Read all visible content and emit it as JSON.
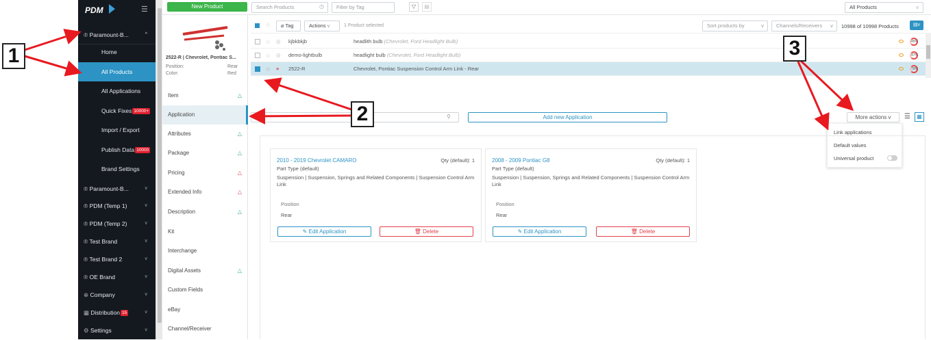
{
  "sidebar": {
    "logo": "PDM",
    "header_brand": "Paramount-B...",
    "items": [
      {
        "label": "Home"
      },
      {
        "label": "All Products"
      },
      {
        "label": "All Applications"
      },
      {
        "label": "Quick Fixes",
        "badge": "10000+"
      },
      {
        "label": "Import / Export"
      },
      {
        "label": "Publish Data",
        "badge": "10000"
      },
      {
        "label": "Brand Settings"
      }
    ],
    "brands": [
      {
        "label": "Paramount-B..."
      },
      {
        "label": "PDM (Temp 1)"
      },
      {
        "label": "PDM (Temp 2)"
      },
      {
        "label": "Test Brand"
      },
      {
        "label": "Test Brand 2"
      },
      {
        "label": "OE Brand"
      },
      {
        "label": "Company"
      },
      {
        "label": "Distribution",
        "badge": "15"
      },
      {
        "label": "Settings"
      }
    ]
  },
  "toolbar": {
    "new_product": "New Product",
    "search_placeholder": "Search Products",
    "filter_placeholder": "Filter by Tag",
    "scope": "All Products"
  },
  "product_preview": {
    "title": "2522-R | Chevrolet, Pontiac S...",
    "position_label": "Position:",
    "position_value": "Rear",
    "color_label": "Color:",
    "color_value": "Red"
  },
  "list_bar": {
    "tag": "Tag",
    "actions": "Actions",
    "selected": "1 Product selected",
    "sort": "Sort products by",
    "channels": "Channels/Receivers",
    "count": "10998 of 10998 Products"
  },
  "rows": [
    {
      "sku": "kjbkbkjb",
      "name": "headlith bulb",
      "fit": "(Chevrolet, Ford Headlight Bulb)",
      "score": "45%"
    },
    {
      "sku": "demo-lightbulb",
      "name": "headlight bulb",
      "fit": "(Chevrolet, Ford Headlight Bulb)",
      "score": "47%"
    },
    {
      "sku": "2522-R",
      "name": "Chevrolet, Pontiac Suspension Control Arm Link - Rear",
      "fit": "",
      "score": "79%"
    }
  ],
  "tabs": [
    {
      "label": "Item",
      "status": "ok"
    },
    {
      "label": "Application",
      "status": ""
    },
    {
      "label": "Attributes",
      "status": "ok"
    },
    {
      "label": "Package",
      "status": "ok"
    },
    {
      "label": "Pricing",
      "status": "warn"
    },
    {
      "label": "Extended Info",
      "status": "warn"
    },
    {
      "label": "Description",
      "status": "ok"
    },
    {
      "label": "Kit",
      "status": ""
    },
    {
      "label": "Interchange",
      "status": ""
    },
    {
      "label": "Digital Assets",
      "status": "ok"
    },
    {
      "label": "Custom Fields",
      "status": ""
    },
    {
      "label": "eBay",
      "status": ""
    },
    {
      "label": "Channel/Receiver",
      "status": ""
    }
  ],
  "app_toolbar": {
    "search_placeholder": "arch",
    "add_new": "Add new Application",
    "more_actions": "More actions"
  },
  "more_menu": {
    "link": "Link applications",
    "defaults": "Default values",
    "universal": "Universal product"
  },
  "cards": [
    {
      "title": "2010 - 2019 Chevrolet CAMARO",
      "qty": "Qty (default): 1",
      "part_type": "Part Type (default)",
      "desc": "Suspension | Suspension, Springs and Related Components | Suspension Control Arm Link",
      "pos_label": "Position",
      "pos_value": "Rear",
      "edit": "Edit Application",
      "delete": "Delete"
    },
    {
      "title": "2008 - 2009 Pontiac G8",
      "qty": "Qty (default): 1",
      "part_type": "Part Type (default)",
      "desc": "Suspension | Suspension, Springs and Related Components | Suspension Control Arm Link",
      "pos_label": "Position",
      "pos_value": "Rear",
      "edit": "Edit Application",
      "delete": "Delete"
    }
  ],
  "callouts": {
    "one": "1",
    "two": "2",
    "three": "3"
  }
}
